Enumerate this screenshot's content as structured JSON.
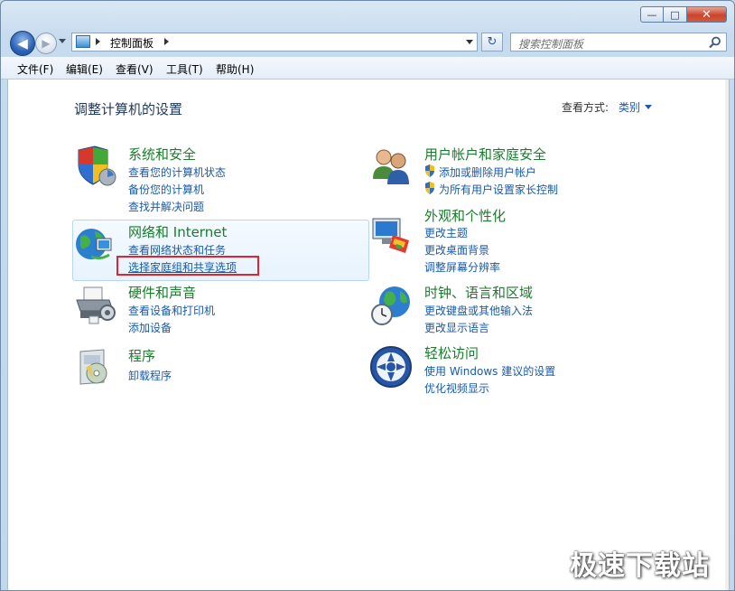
{
  "window": {
    "controls": {
      "minimize": "—",
      "maximize": "□",
      "close": "✕"
    }
  },
  "nav": {
    "back": "◀",
    "forward": "▶",
    "breadcrumb": "控制面板",
    "refresh": "↻",
    "search_placeholder": "搜索控制面板"
  },
  "menu": [
    "文件(F)",
    "编辑(E)",
    "查看(V)",
    "工具(T)",
    "帮助(H)"
  ],
  "content": {
    "heading": "调整计算机的设置",
    "view_mode_label": "查看方式:",
    "view_mode_value": "类别"
  },
  "categories": [
    {
      "title": "系统和安全",
      "links": [
        "查看您的计算机状态",
        "备份您的计算机",
        "查找并解决问题"
      ],
      "icon": "shield-icon"
    },
    {
      "title": "网络和 Internet",
      "links": [
        "查看网络状态和任务",
        "选择家庭组和共享选项"
      ],
      "icon": "network-globe-icon"
    },
    {
      "title": "硬件和声音",
      "links": [
        "查看设备和打印机",
        "添加设备"
      ],
      "icon": "printer-icon"
    },
    {
      "title": "程序",
      "links": [
        "卸载程序"
      ],
      "icon": "programs-icon"
    },
    {
      "title": "用户帐户和家庭安全",
      "links": [
        "添加或删除用户帐户",
        "为所有用户设置家长控制"
      ],
      "icon": "users-icon"
    },
    {
      "title": "外观和个性化",
      "links": [
        "更改主题",
        "更改桌面背景",
        "调整屏幕分辨率"
      ],
      "icon": "monitor-paint-icon"
    },
    {
      "title": "时钟、语言和区域",
      "links": [
        "更改键盘或其他输入法",
        "更改显示语言"
      ],
      "icon": "globe-clock-icon"
    },
    {
      "title": "轻松访问",
      "links": [
        "使用 Windows 建议的设置",
        "优化视频显示"
      ],
      "icon": "ease-access-icon"
    }
  ],
  "watermark": "极速下载站",
  "colors": {
    "title_green": "#1a7c2c",
    "link_blue": "#1a5aa8",
    "highlight_red": "#e0252e"
  }
}
